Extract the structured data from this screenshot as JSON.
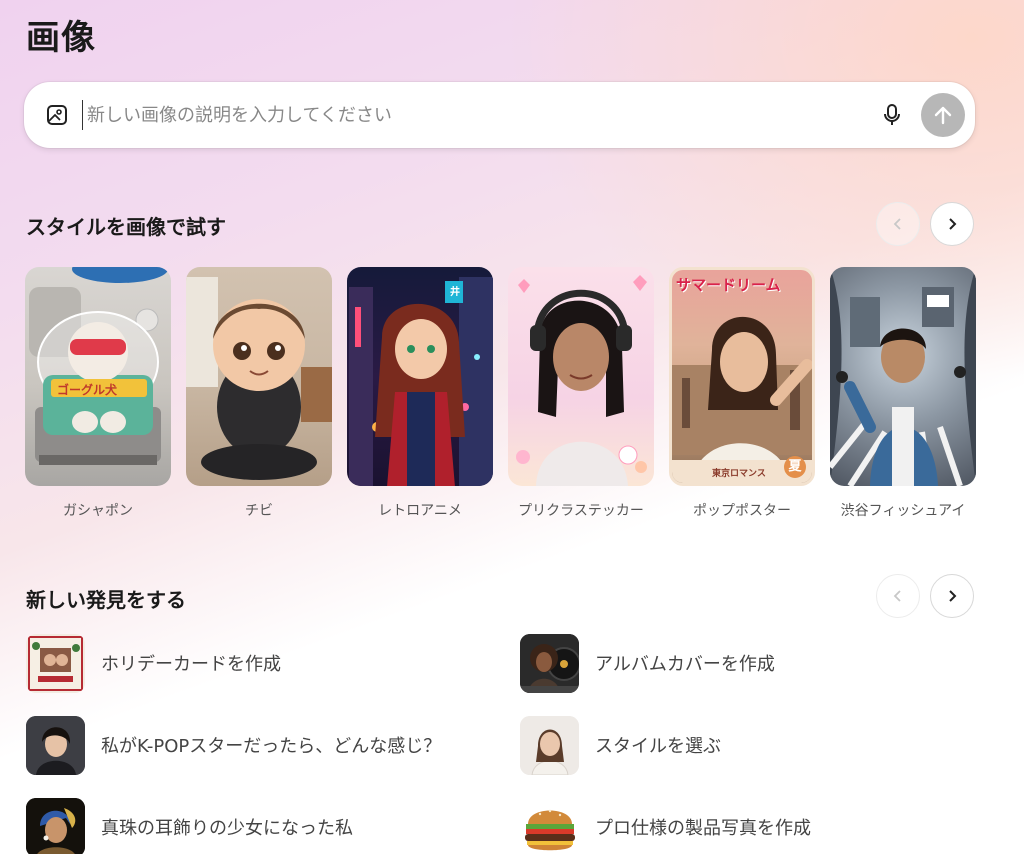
{
  "page": {
    "title": "画像"
  },
  "prompt": {
    "placeholder": "新しい画像の説明を入力してください",
    "upload_icon": "image-upload-icon",
    "mic_icon": "microphone-icon",
    "send_icon": "arrow-up-icon"
  },
  "styles": {
    "title": "スタイルを画像で試す",
    "items": [
      {
        "label": "ガシャポン",
        "thumb_text": "ゴーグル犬"
      },
      {
        "label": "チビ"
      },
      {
        "label": "レトロアニメ",
        "thumb_text": "井"
      },
      {
        "label": "プリクラステッカー"
      },
      {
        "label": "ポップポスター",
        "thumb_text": "サマードリーム",
        "thumb_subtext": "東京ロマンス",
        "thumb_badge": "夏"
      },
      {
        "label": "渋谷フィッシュアイ"
      }
    ]
  },
  "discover": {
    "title": "新しい発見をする",
    "items": [
      {
        "label": "ホリデーカードを作成"
      },
      {
        "label": "アルバムカバーを作成"
      },
      {
        "label": "私がK-POPスターだったら、どんな感じ？"
      },
      {
        "label": "スタイルを選ぶ"
      },
      {
        "label": "真珠の耳飾りの少女になった私"
      },
      {
        "label": "プロ仕様の製品写真を作成"
      }
    ]
  },
  "colors": {
    "send_button": "#b7b7b7",
    "accent_pink": "#f0d2ef",
    "accent_peach": "#ffd6c4"
  }
}
